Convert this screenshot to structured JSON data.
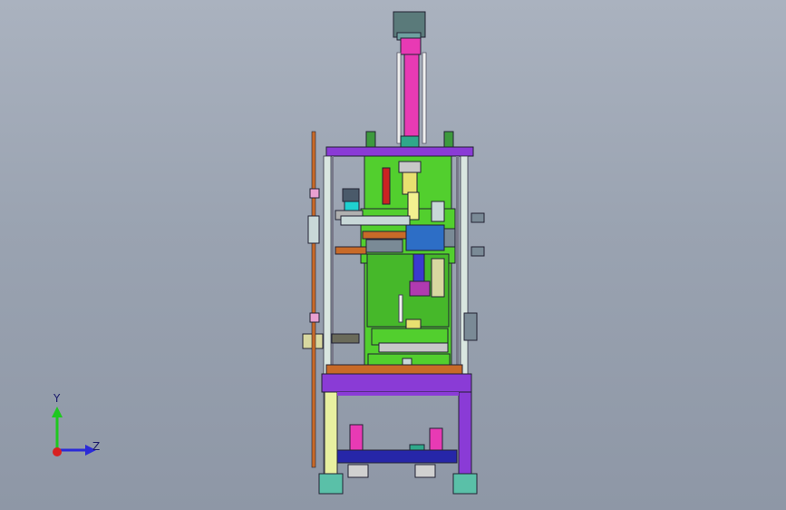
{
  "viewport": {
    "background_top": "#aab2bf",
    "background_bottom": "#8e97a6"
  },
  "model": {
    "colors": {
      "frame_green": "#52cf2e",
      "frame_purple": "#8a3bd6",
      "steel_light": "#c8d8c8",
      "pink_cylinder": "#e83ab4",
      "base_blue": "#2626a8",
      "feet_teal": "#5ac0a8",
      "gray_block": "#7a8a96",
      "blue_block": "#2d6ec6",
      "orange_rail": "#c86a28",
      "yellow_part": "#e8e070"
    }
  },
  "triad": {
    "y_label": "Y",
    "z_label": "Z",
    "y_color": "#1ec81e",
    "z_color": "#2a2ad8",
    "x_color": "#d82020"
  }
}
